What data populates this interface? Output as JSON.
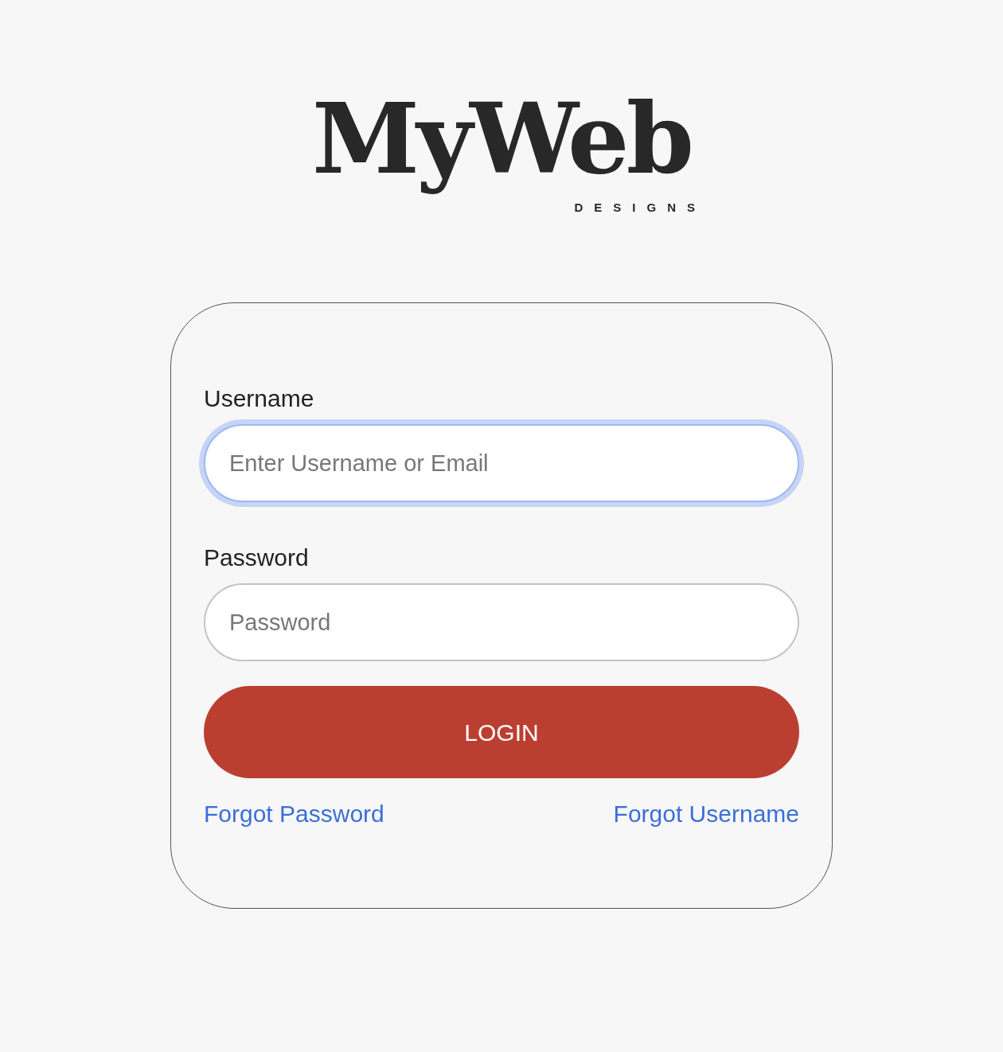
{
  "logo": {
    "title": "MyWeb",
    "subtitle": "DESIGNS"
  },
  "fields": [
    {
      "label": "Username",
      "placeholder": "Enter Username or Email",
      "focused": true
    },
    {
      "label": "Password",
      "placeholder": "Password",
      "focused": false
    }
  ],
  "button": "LOGIN",
  "links": [
    "Forgot Password",
    "Forgot Username"
  ]
}
